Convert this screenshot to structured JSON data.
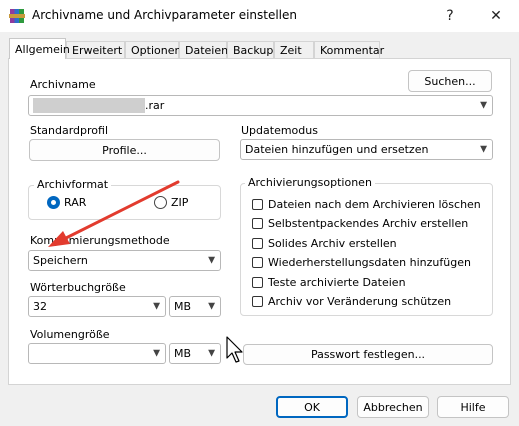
{
  "window": {
    "title": "Archivname und Archivparameter einstellen",
    "help_glyph": "?",
    "close_glyph": "✕",
    "accent_color": "#0067c0"
  },
  "tabs": [
    {
      "label": "Allgemein",
      "active": true
    },
    {
      "label": "Erweitert"
    },
    {
      "label": "Optionen"
    },
    {
      "label": "Dateien"
    },
    {
      "label": "Backup"
    },
    {
      "label": "Zeit"
    },
    {
      "label": "Kommentar"
    }
  ],
  "archive_name": {
    "label": "Archivname",
    "value": ".rar",
    "search_button": "Suchen..."
  },
  "profile": {
    "label": "Standardprofil",
    "button": "Profile..."
  },
  "update_mode": {
    "label": "Updatemodus",
    "value": "Dateien hinzufügen und ersetzen"
  },
  "archive_format": {
    "legend": "Archivformat",
    "options": [
      {
        "label": "RAR",
        "selected": true
      },
      {
        "label": "ZIP",
        "selected": false
      }
    ]
  },
  "compression": {
    "label": "Komprimierungsmethode",
    "value": "Speichern"
  },
  "dictionary": {
    "label": "Wörterbuchgröße",
    "value": "32",
    "unit": "MB"
  },
  "volume": {
    "label": "Volumengröße",
    "value": "",
    "unit": "MB"
  },
  "password_button": "Passwort festlegen...",
  "archiving_options": {
    "legend": "Archivierungsoptionen",
    "items": [
      {
        "label": "Dateien nach dem Archivieren löschen",
        "checked": false
      },
      {
        "label": "Selbstentpackendes Archiv erstellen",
        "checked": false
      },
      {
        "label": "Solides Archiv erstellen",
        "checked": false
      },
      {
        "label": "Wiederherstellungsdaten hinzufügen",
        "checked": false
      },
      {
        "label": "Teste archivierte Dateien",
        "checked": false
      },
      {
        "label": "Archiv vor Veränderung schützen",
        "checked": false
      }
    ]
  },
  "footer": {
    "ok": "OK",
    "cancel": "Abbrechen",
    "help": "Hilfe"
  }
}
